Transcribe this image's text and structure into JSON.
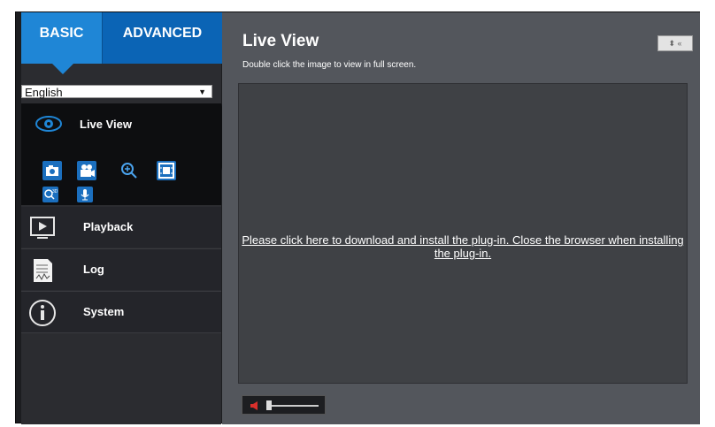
{
  "tabs": {
    "basic": "BASIC",
    "advanced": "ADVANCED"
  },
  "language": {
    "selected": "English"
  },
  "sidebar": {
    "live_view_label": "Live View",
    "items": [
      {
        "label": "Playback",
        "icon": "playback-icon"
      },
      {
        "label": "Log",
        "icon": "log-icon"
      },
      {
        "label": "System",
        "icon": "info-icon"
      }
    ],
    "quick_icons": [
      "snapshot-icon",
      "record-icon",
      "zoom-icon",
      "frame-icon",
      "zoom-3d-icon",
      "microphone-icon"
    ]
  },
  "main": {
    "title": "Live View",
    "subtitle": "Double click the image to view in full screen.",
    "plugin_message": "Please click here to download and install the plug-in. Close the browser when installing the plug-in."
  },
  "colors": {
    "accent": "#1f86d6",
    "background": "#53565c",
    "viewer": "#3f4145"
  }
}
